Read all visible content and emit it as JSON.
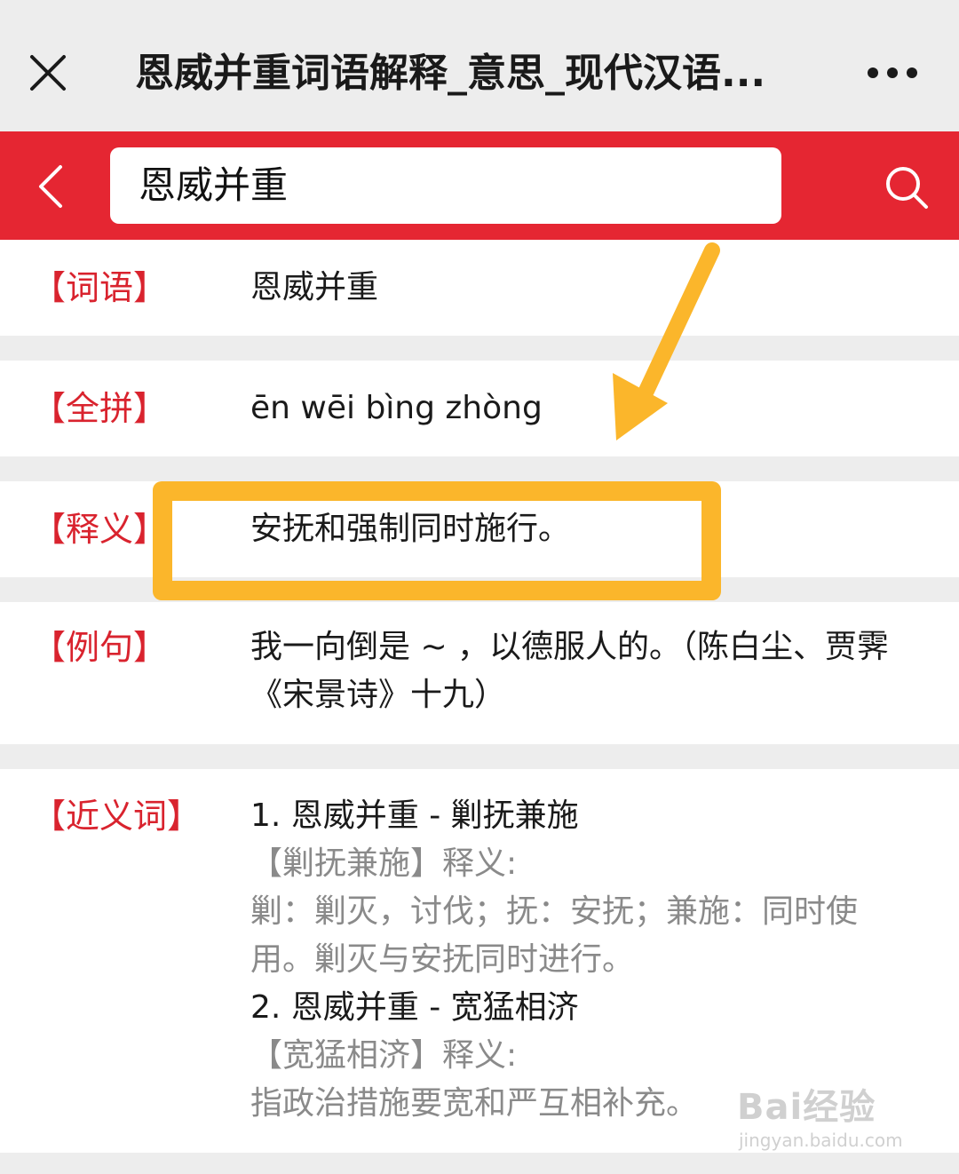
{
  "header": {
    "title": "恩威并重词语解释_意思_现代汉语...",
    "close_icon": "close-icon",
    "more_icon": "more-icon"
  },
  "search": {
    "value": "恩威并重",
    "back_icon": "chevron-left-icon",
    "search_icon": "search-icon"
  },
  "entries": {
    "word": {
      "label": "【词语】",
      "value": "恩威并重"
    },
    "pinyin": {
      "label": "【全拼】",
      "value": "ēn wēi bìng zhòng"
    },
    "meaning": {
      "label": "【释义】",
      "value": "安抚和强制同时施行。"
    },
    "example": {
      "label": "【例句】",
      "value": "我一向倒是 ~ ，以德服人的。（陈白尘、贾霁《宋景诗》十九）"
    },
    "synonyms": {
      "label": "【近义词】",
      "items": [
        {
          "title": "1. 恩威并重 - 剿抚兼施",
          "sub_label": "【剿抚兼施】释义:",
          "explanation": "剿：剿灭，讨伐；抚：安抚；兼施：同时使用。剿灭与安抚同时进行。"
        },
        {
          "title": "2. 恩威并重 - 宽猛相济",
          "sub_label": "【宽猛相济】释义:",
          "explanation": "指政治措施要宽和严互相补充。"
        }
      ]
    }
  },
  "annotation": {
    "color": "#fbb62b"
  },
  "watermark": {
    "main": "Bai经验",
    "sub": "jingyan.baidu.com"
  },
  "colors": {
    "brand_red": "#e52632",
    "label_red": "#d9232e"
  }
}
